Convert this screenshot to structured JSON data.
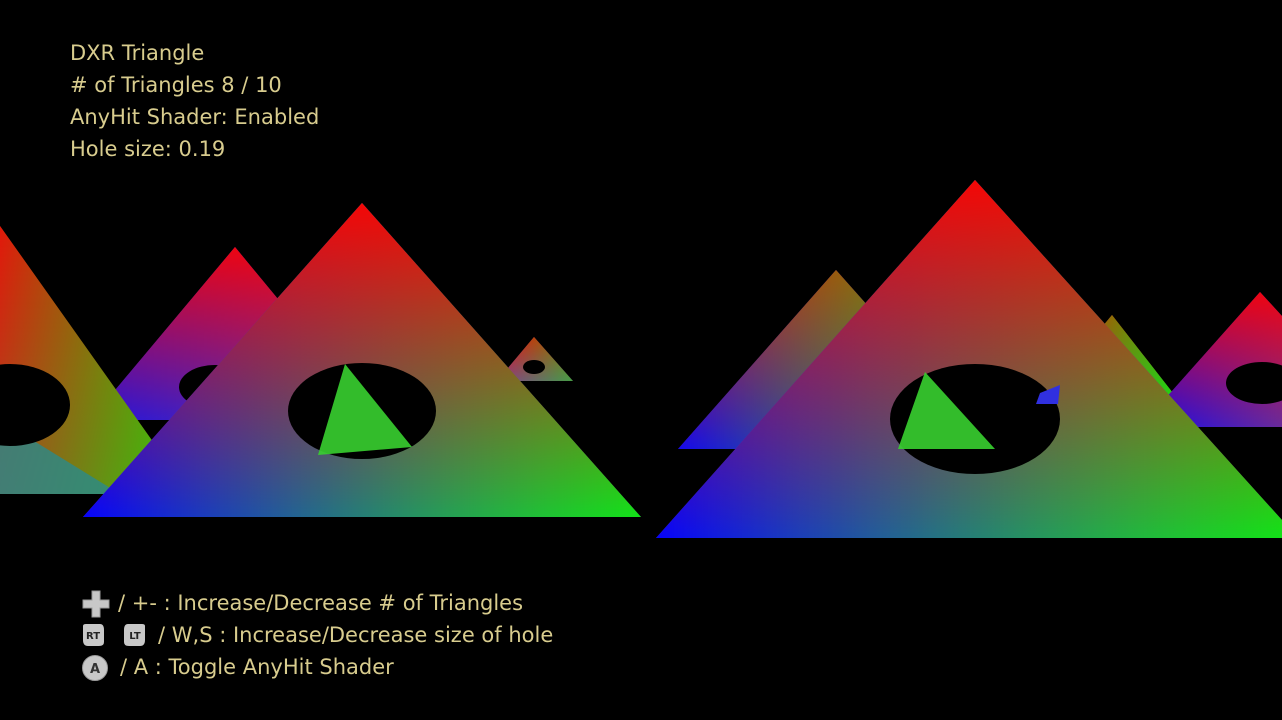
{
  "hud": {
    "title": "DXR Triangle",
    "triangle_count": "# of Triangles 8 / 10",
    "anyhit_status": "AnyHit Shader: Enabled",
    "hole_size": "Hole size: 0.19"
  },
  "help": {
    "triangles": {
      "icon": "dpad-icon",
      "text": "/ +- : Increase/Decrease # of Triangles"
    },
    "hole": {
      "icons": [
        "rt-trigger-icon",
        "lt-trigger-icon"
      ],
      "icon_labels": [
        "RT",
        "LT"
      ],
      "text": "/ W,S : Increase/Decrease size of hole"
    },
    "anyhit": {
      "icon": "a-button-icon",
      "icon_label": "A",
      "text": "/ A : Toggle AnyHit Shader"
    }
  },
  "colors": {
    "background": "#000000",
    "hud_text": "#d8cc8e",
    "vertex_top": "#ff0000",
    "vertex_left": "#0000ff",
    "vertex_right": "#00ff00",
    "button_icon": "#c8c8c8"
  }
}
